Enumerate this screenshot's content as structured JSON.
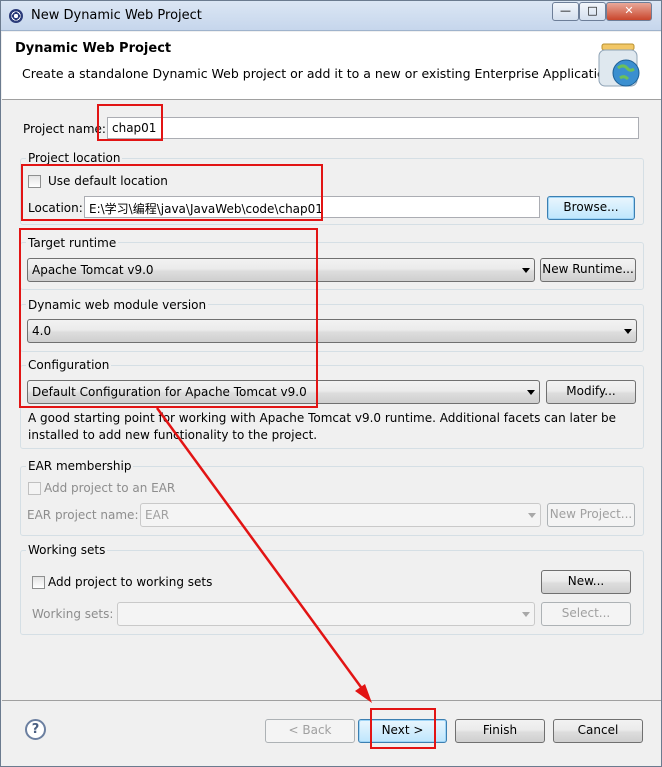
{
  "window": {
    "title": "New Dynamic Web Project"
  },
  "banner": {
    "title": "Dynamic Web Project",
    "description": "Create a standalone Dynamic Web project or add it to a new or existing Enterprise Application."
  },
  "project_name": {
    "label": "Project name:",
    "value": "chap01"
  },
  "project_location": {
    "group_title": "Project location",
    "use_default_label": "Use default location",
    "use_default_checked": false,
    "location_label": "Location:",
    "location_value": "E:\\学习\\编程\\java\\JavaWeb\\code\\chap01",
    "browse_label": "Browse..."
  },
  "target_runtime": {
    "group_title": "Target runtime",
    "value": "Apache Tomcat v9.0",
    "new_runtime_label": "New Runtime..."
  },
  "module_version": {
    "group_title": "Dynamic web module version",
    "value": "4.0"
  },
  "configuration": {
    "group_title": "Configuration",
    "value": "Default Configuration for Apache Tomcat v9.0",
    "modify_label": "Modify...",
    "description_line1": "A good starting point for working with Apache Tomcat v9.0 runtime. Additional facets can later be",
    "description_line2": "installed to add new functionality to the project."
  },
  "ear": {
    "group_title": "EAR membership",
    "add_label": "Add project to an EAR",
    "project_name_label": "EAR project name:",
    "project_name_value": "EAR",
    "new_project_label": "New Project..."
  },
  "working_sets": {
    "group_title": "Working sets",
    "add_label": "Add project to working sets",
    "new_label": "New...",
    "sets_label": "Working sets:",
    "select_label": "Select..."
  },
  "footer": {
    "help_symbol": "?",
    "back_label": "< Back",
    "next_label": "Next >",
    "finish_label": "Finish",
    "cancel_label": "Cancel"
  },
  "colors": {
    "annotation": "#e21414",
    "window_border": "#6b7b8f"
  }
}
